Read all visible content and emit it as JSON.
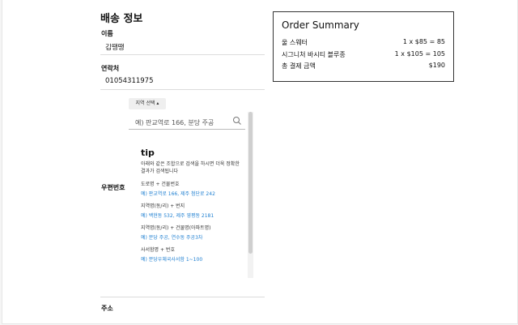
{
  "shipping": {
    "title": "배송 정보",
    "name_label": "이름",
    "name_value": "김땡땡",
    "phone_label": "연락처",
    "phone_value": "01054311975",
    "region_button": "지역 선택 ▴",
    "search_placeholder": "예) 판교역로 166, 분당 주공",
    "zip_label": "우편번호",
    "address_label": "주소",
    "tip": {
      "title": "tip",
      "desc": "아래와 같은 조합으로 검색을 하시면 더욱 정확한 결과가 검색됩니다",
      "examples": [
        {
          "title": "도로명 + 건물번호",
          "value": "예) 판교역로 166, 제주 첨단로 242"
        },
        {
          "title": "지역명(동/리) + 번지",
          "value": "예) 백현동 532, 제주 영평동 2181"
        },
        {
          "title": "지역명(동/리) + 건물명(아파트명)",
          "value": "예) 분당 주공, 연수동 주공3차"
        },
        {
          "title": "사서함명 + 번호",
          "value": "예) 분당우체국사서함 1~100"
        }
      ]
    }
  },
  "summary": {
    "title": "Order Summary",
    "items": [
      {
        "name": "울 스웨터",
        "price": "1 x $85 = 85"
      },
      {
        "name": "시그니처 바시티 블루종",
        "price": "1 x $105 = 105"
      }
    ],
    "total_label": "총 결제 금액",
    "total_value": "$190"
  }
}
